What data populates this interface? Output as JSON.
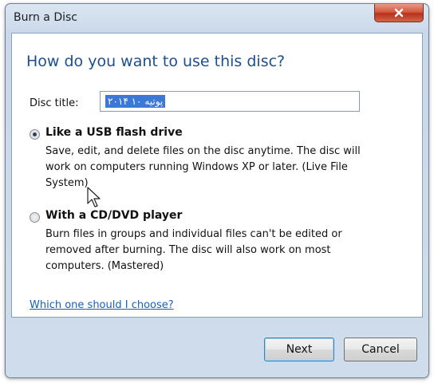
{
  "window": {
    "title": "Burn a Disc"
  },
  "heading": "How do you want to use this disc?",
  "disc_title": {
    "label": "Disc title:",
    "value": "پوتیه ۱۰ ۲۰۱۴"
  },
  "options": [
    {
      "label": "Like a USB flash drive",
      "desc_lines": [
        "Save, edit, and delete files on the disc anytime. The disc will",
        "work on computers running Windows XP or later. (Live File",
        "System)"
      ],
      "selected": true
    },
    {
      "label": "With a CD/DVD player",
      "desc_lines": [
        "Burn files in groups and individual files can't be edited or",
        "removed after burning. The disc will also work on most",
        "computers. (Mastered)"
      ],
      "selected": false
    }
  ],
  "help_link": "Which one should I choose?",
  "buttons": {
    "next": "Next",
    "cancel": "Cancel"
  },
  "icons": {
    "close": "close-icon",
    "cursor": "mouse-pointer-icon"
  }
}
